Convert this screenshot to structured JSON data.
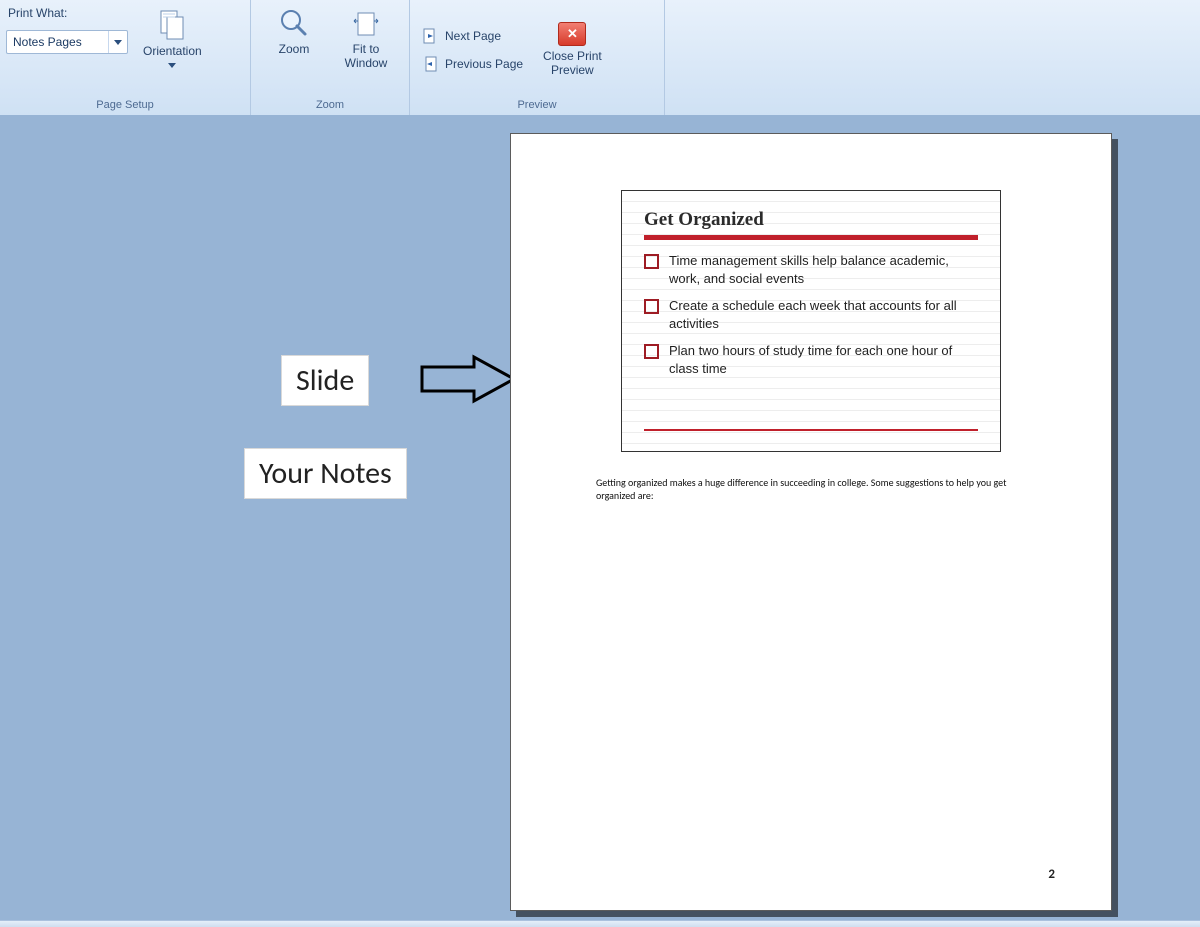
{
  "ribbon": {
    "print_what_label": "Print What:",
    "print_what_value": "Notes Pages",
    "orientation": "Orientation",
    "zoom": "Zoom",
    "fit_to_window": "Fit to\nWindow",
    "next_page": "Next Page",
    "previous_page": "Previous Page",
    "close_preview": "Close Print\nPreview",
    "groups": {
      "page_setup": "Page Setup",
      "zoom": "Zoom",
      "preview": "Preview"
    }
  },
  "annotations": {
    "slide": "Slide",
    "notes": "Your Notes"
  },
  "page": {
    "number": "2",
    "slide": {
      "title": "Get Organized",
      "bullets": [
        "Time management  skills help balance academic, work, and social events",
        "Create a schedule  each week that accounts for all activities",
        "Plan two hours of study time for each one hour of class time"
      ]
    },
    "notes_text": "Getting organized makes a huge difference in succeeding  in college. Some suggestions to help you get organized are:"
  }
}
